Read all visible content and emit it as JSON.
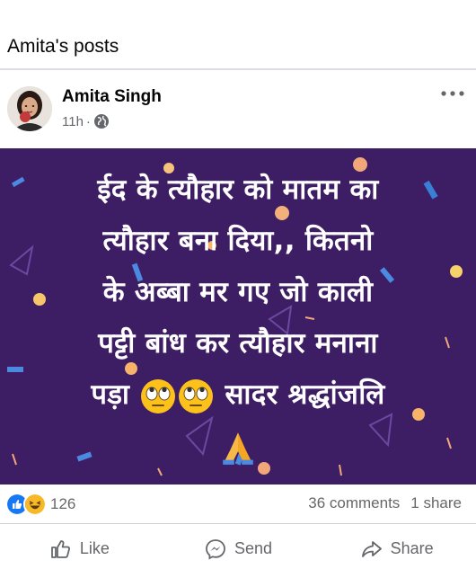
{
  "header": {
    "title": "Amita's posts"
  },
  "post": {
    "author": "Amita Singh",
    "time": "11h",
    "separator": "·",
    "image_text": {
      "line1": "ईद के त्यौहार को मातम का",
      "line2": "त्यौहार बना दिया,, कितनो",
      "line3": "के अब्बा मर गए जो काली",
      "line4": "पट्टी बांध कर त्यौहार मनाना",
      "line5_start": "पड़ा",
      "line5_end": "सादर श्रद्धांजलि"
    },
    "icons": {
      "privacy": "globe-icon",
      "more": "more-options-icon",
      "emoji": "face-with-rolling-eyes",
      "hands": "folded-hands"
    },
    "background_color": "#3d1d63"
  },
  "stats": {
    "reaction_count": "126",
    "comments": "36 comments",
    "shares": "1 share"
  },
  "actions": {
    "like": "Like",
    "send": "Send",
    "share": "Share"
  },
  "colors": {
    "like_blue": "#1877f2",
    "haha_yellow": "#f7b928",
    "secondary_text": "#65676b"
  }
}
